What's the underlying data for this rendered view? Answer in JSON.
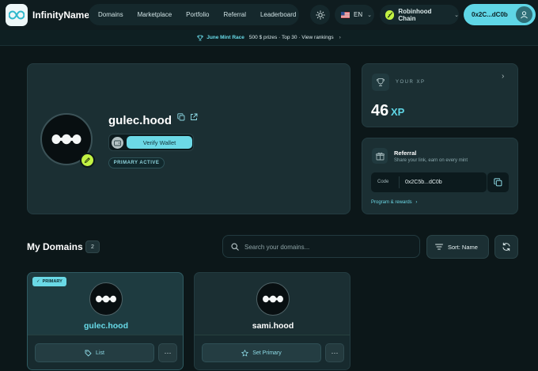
{
  "header": {
    "brand": "InfinityName",
    "nav": [
      "Domains",
      "Marketplace",
      "Portfolio",
      "Referral",
      "Leaderboard"
    ],
    "language": "EN",
    "chain": "Robinhood Chain",
    "wallet": "0x2C...dC0b"
  },
  "announcement": {
    "highlight": "June Mint Race",
    "text": "500 $ prizes · Top 30 · View rankings"
  },
  "profile": {
    "name": "gulec.hood",
    "verify_label": "Verify Wallet",
    "status": "PRIMARY ACTIVE"
  },
  "xp": {
    "label": "YOUR XP",
    "value": "46",
    "unit": "XP"
  },
  "referral": {
    "title": "Referral",
    "subtitle": "Share your link, earn on every mint",
    "code_label": "Code",
    "code": "0x2C5b...dC0b",
    "link": "Program & rewards"
  },
  "domains": {
    "title": "My Domains",
    "count": "2",
    "search_placeholder": "Search your domains...",
    "sort_label": "Sort: Name",
    "items": [
      {
        "name": "gulec.hood",
        "tag": "PRIMARY",
        "action": "List",
        "name_color": "#68dbe9"
      },
      {
        "name": "sami.hood",
        "action": "Set Primary",
        "name_color": "#ffffff"
      }
    ]
  },
  "colors": {
    "accent": "#5fd6e6",
    "background": "#0c1719",
    "card": "#1b2f33",
    "badge_lime": "#c2f243"
  }
}
